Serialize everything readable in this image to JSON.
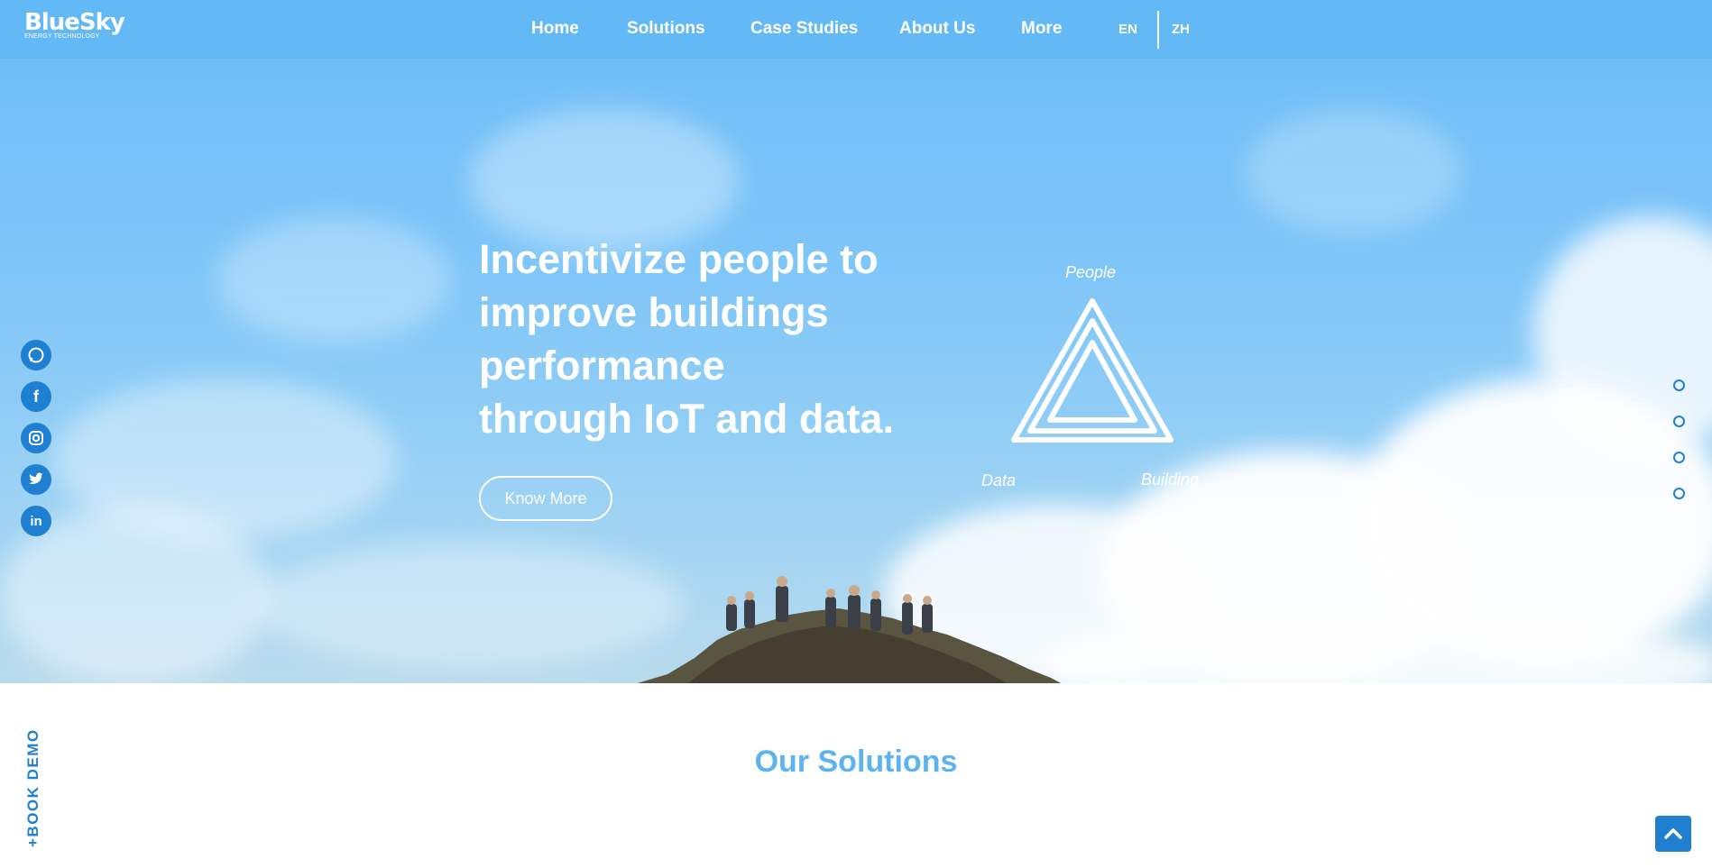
{
  "brand": {
    "name": "BlueSky",
    "tagline": "ENERGY TECHNOLOGY"
  },
  "nav": {
    "items": [
      {
        "label": "Home"
      },
      {
        "label": "Solutions"
      },
      {
        "label": "Case Studies"
      },
      {
        "label": "About Us"
      },
      {
        "label": "More"
      }
    ],
    "languages": [
      "EN",
      "ZH"
    ]
  },
  "hero": {
    "headline_lines": [
      "Incentivize people to",
      "improve buildings",
      "performance",
      "through IoT and data."
    ],
    "button_label": "Know More",
    "triangle_labels": {
      "top": "People",
      "left": "Data",
      "right": "Building"
    }
  },
  "social": [
    "whatsapp-icon",
    "facebook-icon",
    "instagram-icon",
    "twitter-icon",
    "linkedin-icon"
  ],
  "slide_dots": 4,
  "book_demo": "+BOOK DEMO",
  "solutions": {
    "title": "Our Solutions"
  },
  "colors": {
    "nav_bg": "#63b8f6",
    "accent": "#1f7fd0",
    "title": "#5db3f0"
  }
}
